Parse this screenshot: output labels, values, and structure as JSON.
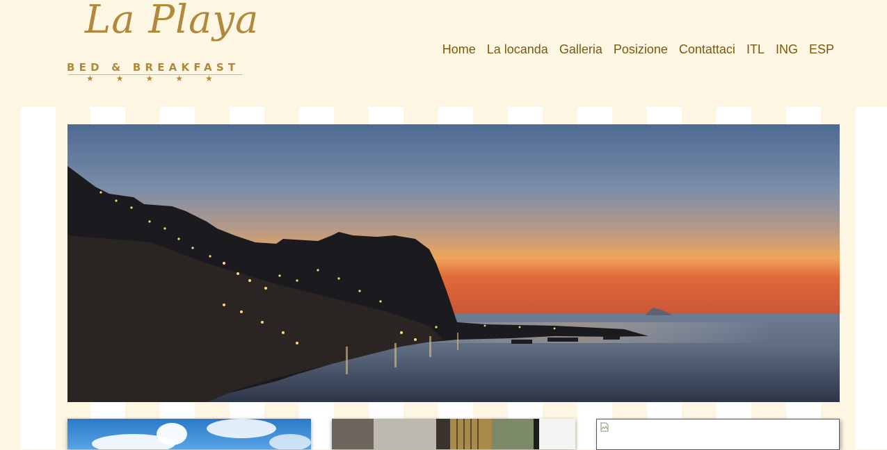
{
  "logo": {
    "script_text": "La Playa",
    "subtitle": "BED & BREAKFAST",
    "stars": "★★★★★",
    "brand_color": "#b08a3c"
  },
  "nav": {
    "items": [
      {
        "label": "Home"
      },
      {
        "label": "La locanda"
      },
      {
        "label": "Galleria"
      },
      {
        "label": "Posizione"
      },
      {
        "label": "Contattaci"
      },
      {
        "label": "ITL"
      },
      {
        "label": "ING"
      },
      {
        "label": "ESP"
      }
    ],
    "color": "#7a5a0e"
  },
  "colors": {
    "page_background": "#fdf6e3",
    "stripe_light": "#ffffff"
  },
  "hero": {
    "icon": "sunset-harbor-photo"
  },
  "thumbnails": [
    {
      "icon": "sky-photo"
    },
    {
      "icon": "interior-photo"
    },
    {
      "icon": "broken-image-icon"
    }
  ]
}
